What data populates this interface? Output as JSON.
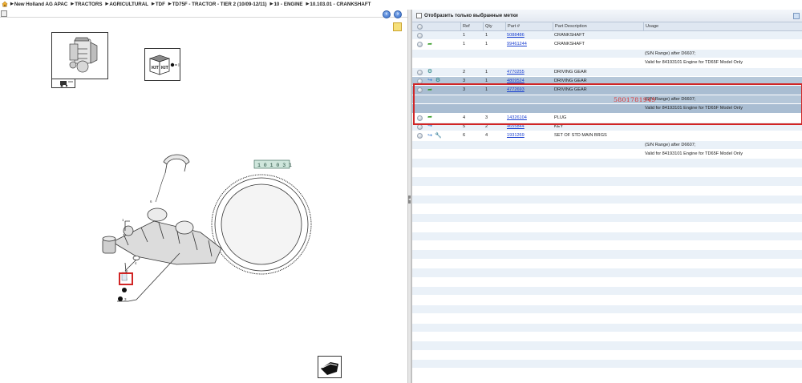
{
  "breadcrumb": {
    "items": [
      "New Holland AG APAC",
      "TRACTORS",
      "AGRICULTURAL",
      "TDF",
      "TD75F - TRACTOR - TIER 2 (10/09-12/11)",
      "10 - ENGINE",
      "10.103.01 - CRANKSHAFT"
    ]
  },
  "diagram": {
    "kit_label_1": "KIT",
    "kit_label_2": "KIT",
    "kit_legend": "= I",
    "callout_6": "6",
    "callout_1": "1",
    "callout_4": "4",
    "callout_2": "2",
    "callout_3": "3",
    "callout_5": "5",
    "ref_plate": "1 0 1 0 3 1"
  },
  "filter": {
    "label": "Отобразить только выбранные метки"
  },
  "grid": {
    "headers": {
      "ref": "Ref",
      "qty": "Qty",
      "part": "Part #",
      "desc": "Part Description",
      "usage": "Usage"
    },
    "rows": [
      {
        "ref": "1",
        "qty": "1",
        "part": "5088486",
        "desc": "CRANKSHAFT",
        "usage": "",
        "icons": []
      },
      {
        "ref": "1",
        "qty": "1",
        "part": "99461244",
        "desc": "CRANKSHAFT",
        "usage": "",
        "icons": [
          "arrow-green"
        ]
      },
      {
        "ref": "",
        "qty": "",
        "part": "",
        "desc": "",
        "usage": "(S/N Range) after D6607;",
        "icons": []
      },
      {
        "ref": "",
        "qty": "",
        "part": "",
        "desc": "",
        "usage": "Valid for 84193101 Engine for TD65F Model Only",
        "icons": []
      },
      {
        "ref": "2",
        "qty": "1",
        "part": "4770255",
        "desc": "DRIVING GEAR",
        "usage": "",
        "icons": [
          "gear-teal"
        ]
      },
      {
        "ref": "3",
        "qty": "1",
        "part": "4809524",
        "desc": "DRIVING GEAR",
        "usage": "",
        "icons": [
          "arrow-blue",
          "gear-teal"
        ]
      },
      {
        "ref": "3",
        "qty": "1",
        "part": "4772693",
        "desc": "DRIVING GEAR",
        "usage": "",
        "icons": [
          "arrow-green"
        ]
      },
      {
        "ref": "",
        "qty": "",
        "part": "",
        "desc": "",
        "usage": "(S/N Range) after D6607;",
        "icons": []
      },
      {
        "ref": "",
        "qty": "",
        "part": "",
        "desc": "",
        "usage": "Valid for 84193101 Engine for TD65F Model Only",
        "icons": []
      },
      {
        "ref": "4",
        "qty": "3",
        "part": "14326104",
        "desc": "PLUG",
        "usage": "",
        "icons": [
          "arrow-green"
        ]
      },
      {
        "ref": "5",
        "qty": "2",
        "part": "4655844",
        "desc": "KEY",
        "usage": "",
        "icons": [
          "arrow-blue"
        ]
      },
      {
        "ref": "6",
        "qty": "4",
        "part": "1931269",
        "desc": "SET OF STD MAIN BRGS",
        "usage": "",
        "icons": [
          "arrow-blue",
          "wrench"
        ]
      },
      {
        "ref": "",
        "qty": "",
        "part": "",
        "desc": "",
        "usage": "(S/N Range) after D6607;",
        "icons": []
      },
      {
        "ref": "",
        "qty": "",
        "part": "",
        "desc": "",
        "usage": "Valid for 84193101 Engine for TD65F Model Only",
        "icons": []
      }
    ],
    "annotation_number": "5801781949"
  },
  "colors": {
    "highlight": "#b5c7d9",
    "alt_row": "#eaf1f8",
    "link": "#1a3fd0",
    "annotation_red": "#e03030"
  }
}
